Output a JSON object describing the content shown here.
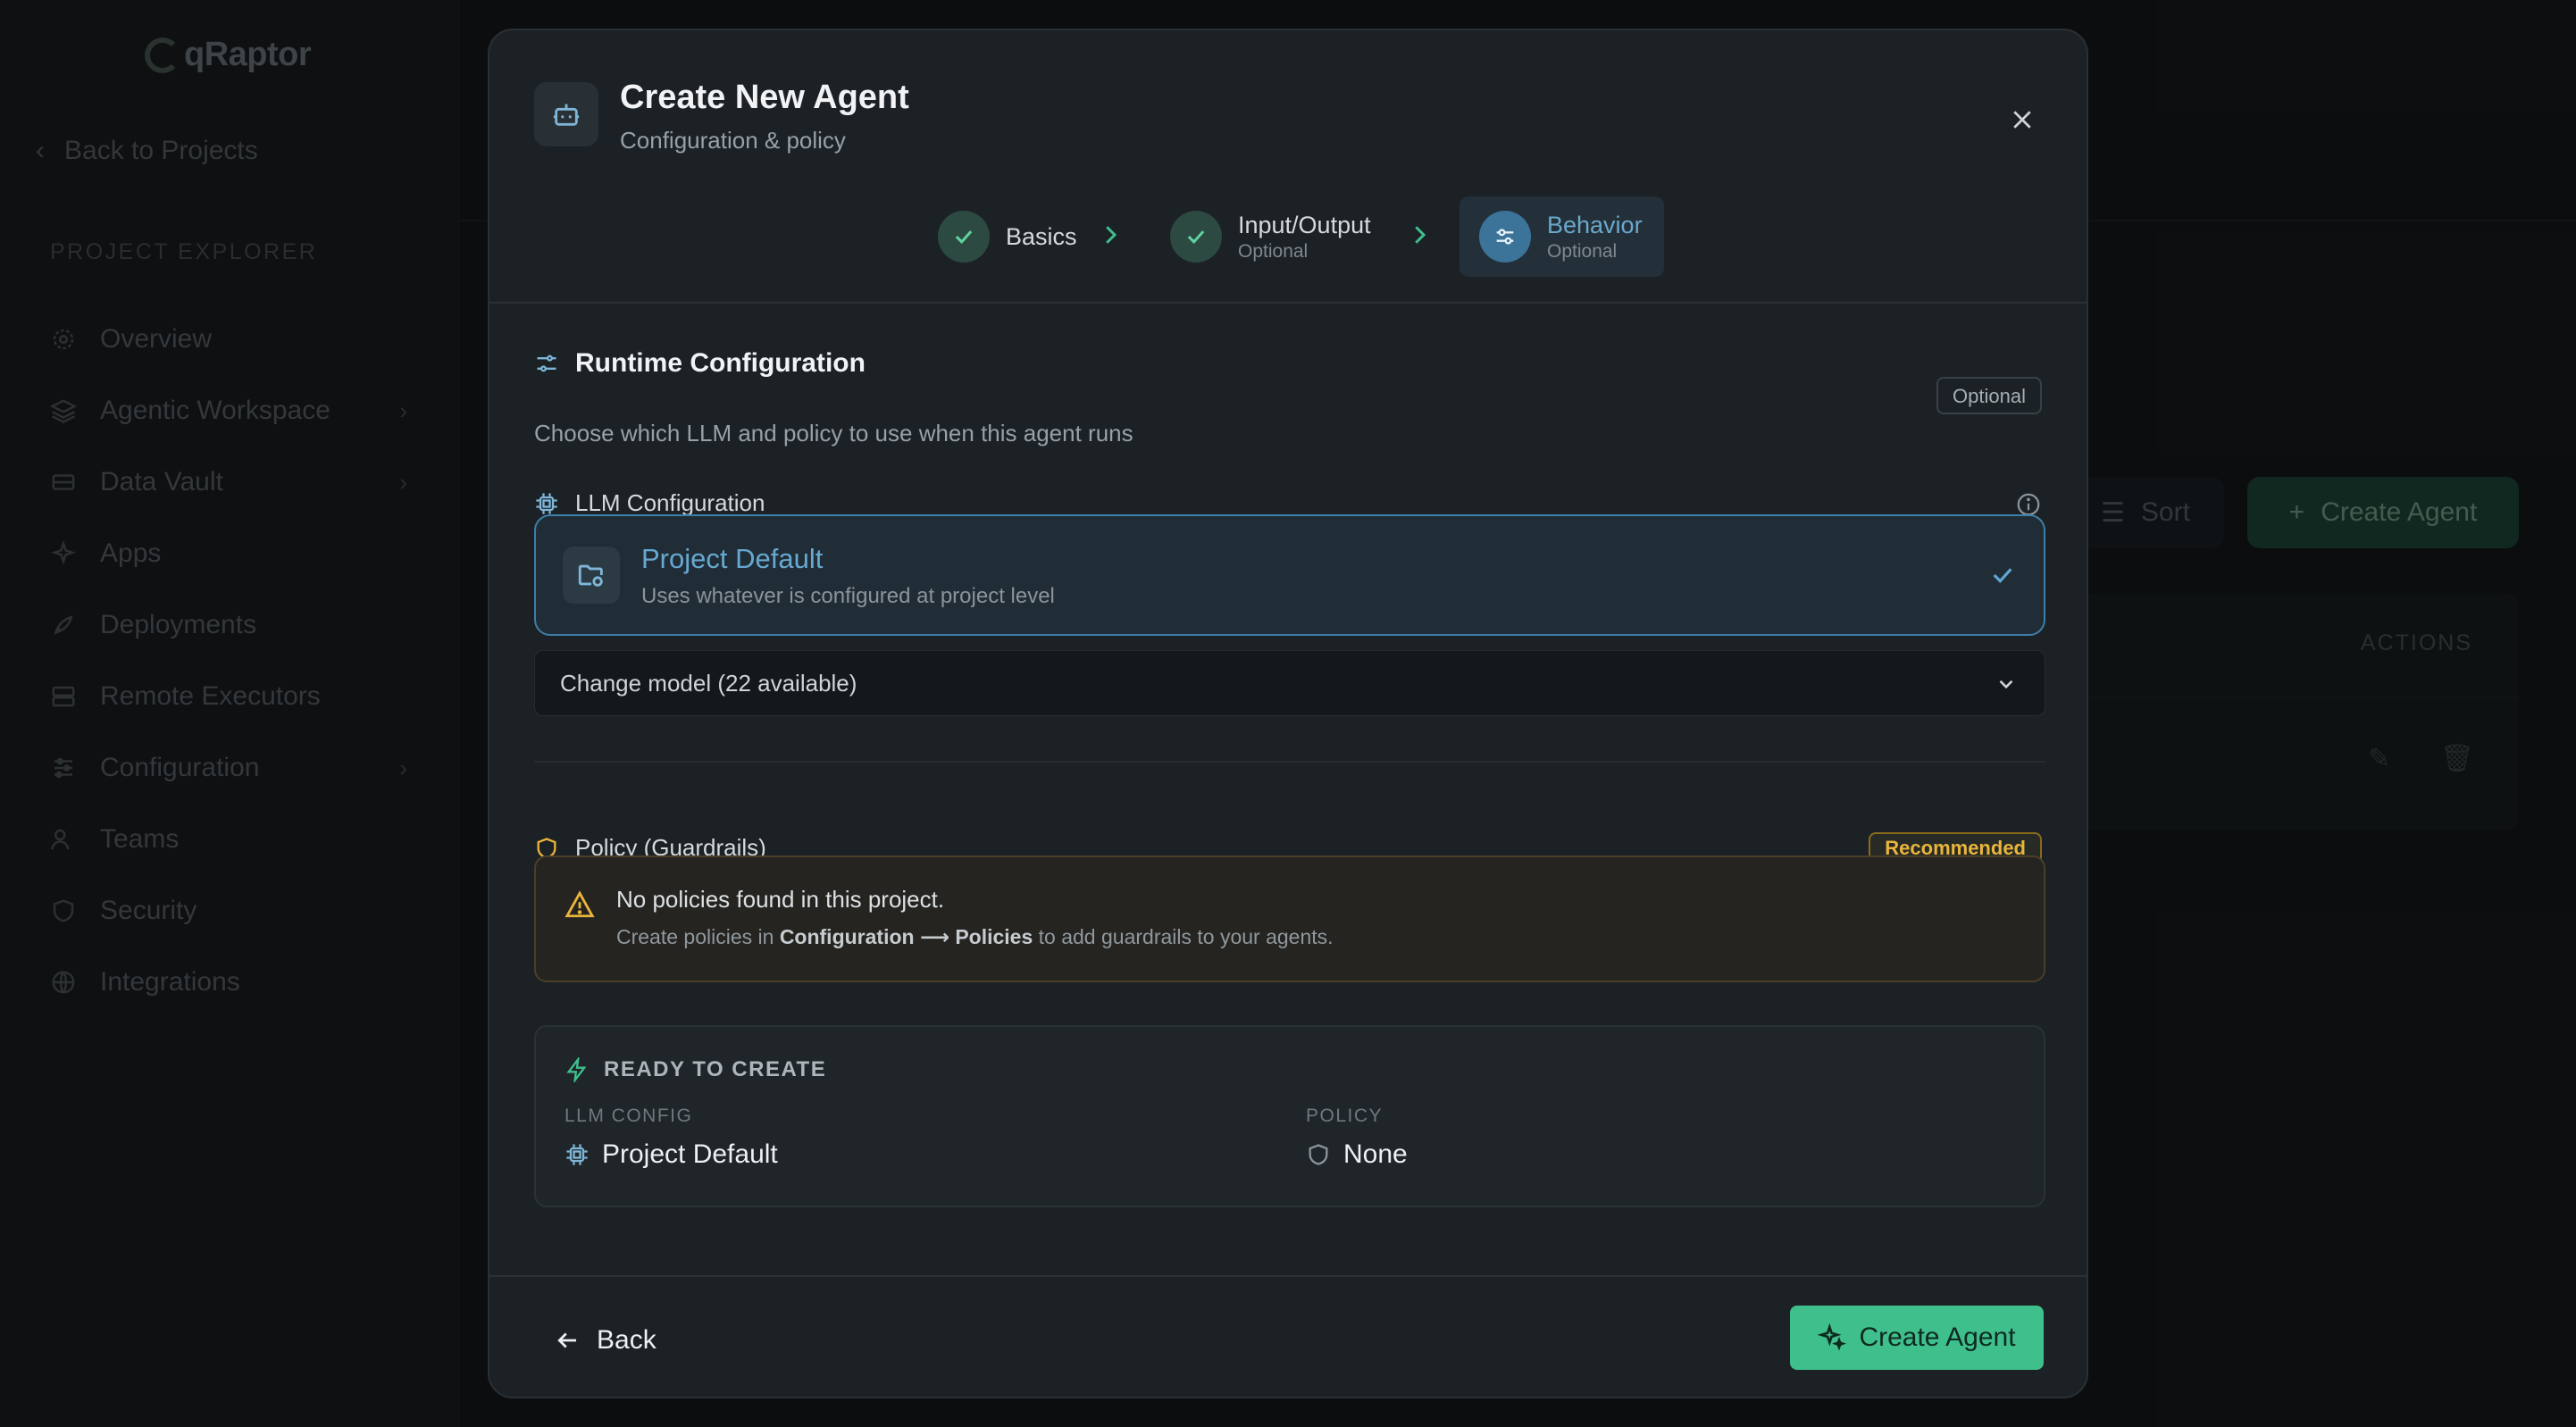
{
  "background": {
    "logo_text": "qRaptor",
    "back_link": "Back to Projects",
    "explorer_title": "PROJECT EXPLORER",
    "nav_items": [
      {
        "label": "Overview",
        "icon": "gear-icon"
      },
      {
        "label": "Agentic Workspace",
        "icon": "layers-icon",
        "chevron": true
      },
      {
        "label": "Data Vault",
        "icon": "database-icon",
        "chevron": true
      },
      {
        "label": "Apps",
        "icon": "sparkles-icon"
      },
      {
        "label": "Deployments",
        "icon": "rocket-icon"
      },
      {
        "label": "Remote Executors",
        "icon": "server-icon"
      },
      {
        "label": "Configuration",
        "icon": "sliders-icon",
        "chevron": true
      },
      {
        "label": "Teams",
        "icon": "users-icon"
      },
      {
        "label": "Security",
        "icon": "shield-icon"
      },
      {
        "label": "Integrations",
        "icon": "globe-icon"
      }
    ],
    "sort_label": "Sort",
    "create_agent_label": "Create Agent",
    "actions_header": "ACTIONS"
  },
  "modal": {
    "title": "Create New Agent",
    "subtitle": "Configuration & policy",
    "steps": [
      {
        "label": "Basics",
        "optional": "",
        "state": "done"
      },
      {
        "label": "Input/Output",
        "optional": "Optional",
        "state": "done"
      },
      {
        "label": "Behavior",
        "optional": "Optional",
        "state": "active"
      }
    ],
    "runtime": {
      "title": "Runtime Configuration",
      "subtitle": "Choose which LLM and policy to use when this agent runs",
      "badge": "Optional"
    },
    "llm": {
      "heading": "LLM Configuration",
      "selected_name": "Project Default",
      "selected_desc": "Uses whatever is configured at project level",
      "dropdown_label": "Change model (22 available)"
    },
    "policy": {
      "heading": "Policy (Guardrails)",
      "badge": "Recommended",
      "warning_title": "No policies found in this project.",
      "warning_pre": "Create policies in ",
      "warning_path_a": "Configuration",
      "warning_arrow": "⟶",
      "warning_path_b": "Policies",
      "warning_post": " to add guardrails to your agents."
    },
    "summary": {
      "heading": "READY TO CREATE",
      "llm_key": "LLM CONFIG",
      "llm_value": "Project Default",
      "policy_key": "POLICY",
      "policy_value": "None"
    },
    "footer": {
      "back_label": "Back",
      "create_label": "Create Agent"
    }
  },
  "colors": {
    "accent_blue": "#67a8d0",
    "accent_green": "#3fbf8c",
    "warning_amber": "#e9b53b"
  }
}
